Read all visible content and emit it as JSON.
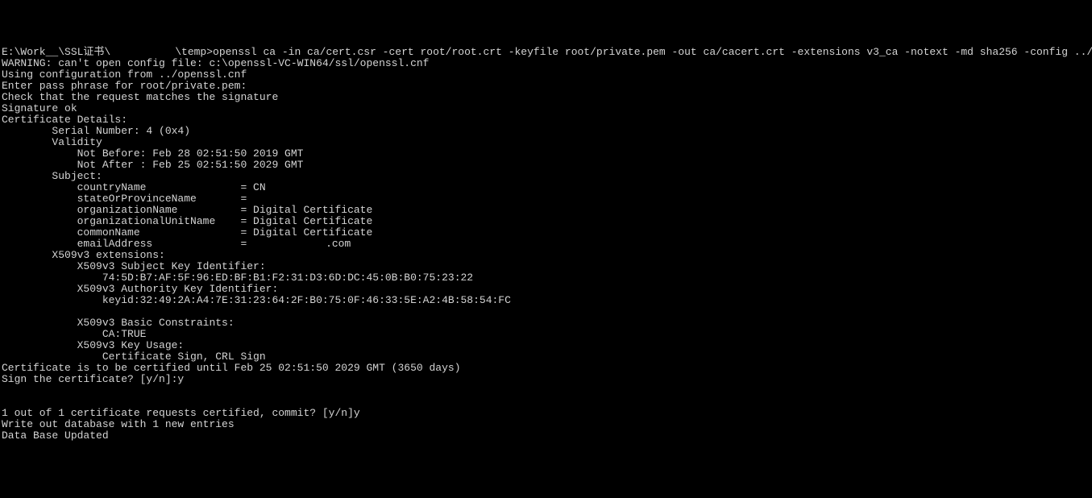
{
  "prompt": {
    "path_prefix": "E:\\Work__\\SSL证书\\",
    "redact1_width": 80,
    "path_suffix": "\\temp>",
    "command": "openssl ca -in ca/cert.csr -cert root/root.crt -keyfile root/private.pem -out ca/cacert.crt -extensions v3_ca -notext -md sha256 -config ../openssl.cnf"
  },
  "lines": {
    "l01": "WARNING: can't open config file: c:\\openssl-VC-WIN64/ssl/openssl.cnf",
    "l02": "Using configuration from ../openssl.cnf",
    "l03": "Enter pass phrase for root/private.pem:",
    "l04": "Check that the request matches the signature",
    "l05": "Signature ok",
    "l06": "Certificate Details:",
    "l07": "        Serial Number: 4 (0x4)",
    "l08": "        Validity",
    "l09": "            Not Before: Feb 28 02:51:50 2019 GMT",
    "l10": "            Not After : Feb 25 02:51:50 2029 GMT",
    "l11": "        Subject:",
    "l12": "            countryName               = CN",
    "l13a": "            stateOrProvinceName       = ",
    "l14": "            organizationName          = Digital Certificate",
    "l15": "            organizationalUnitName    = Digital Certificate",
    "l16": "            commonName                = Digital Certificate",
    "l17a": "            emailAddress              = ",
    "l17b": ".com",
    "l18": "        X509v3 extensions:",
    "l19": "            X509v3 Subject Key Identifier: ",
    "l20": "                74:5D:B7:AF:5F:96:ED:BF:B1:F2:31:D3:6D:DC:45:0B:B0:75:23:22",
    "l21": "            X509v3 Authority Key Identifier: ",
    "l22": "                keyid:32:49:2A:A4:7E:31:23:64:2F:B0:75:0F:46:33:5E:A2:4B:58:54:FC",
    "l23": "",
    "l24": "            X509v3 Basic Constraints: ",
    "l25": "                CA:TRUE",
    "l26": "            X509v3 Key Usage: ",
    "l27": "                Certificate Sign, CRL Sign",
    "l28": "Certificate is to be certified until Feb 25 02:51:50 2029 GMT (3650 days)",
    "l29": "Sign the certificate? [y/n]:y",
    "l30": "",
    "l31": "",
    "l32": "1 out of 1 certificate requests certified, commit? [y/n]y",
    "l33": "Write out database with 1 new entries",
    "l34": "Data Base Updated"
  },
  "redact": {
    "state_width": 55,
    "email_width": 90
  }
}
